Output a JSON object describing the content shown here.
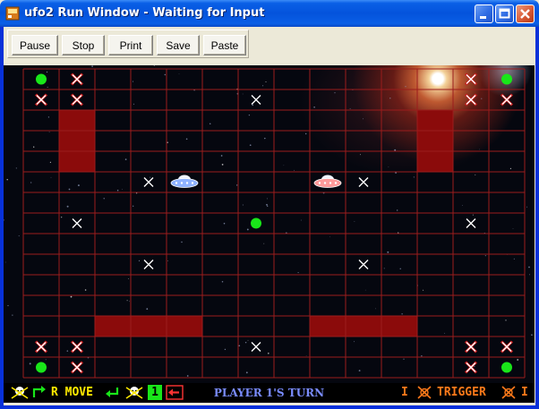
{
  "window": {
    "title": "ufo2 Run Window - Waiting for Input"
  },
  "toolbar": {
    "buttons": [
      {
        "id": "pause",
        "label": "Pause"
      },
      {
        "id": "stop",
        "label": "Stop"
      },
      {
        "id": "print",
        "label": "Print"
      },
      {
        "id": "save",
        "label": "Save"
      },
      {
        "id": "paste",
        "label": "Paste"
      }
    ]
  },
  "game": {
    "grid": {
      "cols": 14,
      "rows": 15
    },
    "colors": {
      "grid_line": "#9b1c1c",
      "wall": "#8b0b0b",
      "orb": "#19e619",
      "mark": "#ffffff"
    },
    "walls": [
      {
        "col": 1,
        "row": 2,
        "w": 1,
        "h": 3
      },
      {
        "col": 11,
        "row": 2,
        "w": 1,
        "h": 3
      },
      {
        "col": 2,
        "row": 12,
        "w": 3,
        "h": 1
      },
      {
        "col": 8,
        "row": 12,
        "w": 3,
        "h": 1
      }
    ],
    "orbs": [
      {
        "col": 0,
        "row": 0
      },
      {
        "col": 13,
        "row": 0
      },
      {
        "col": 6,
        "row": 7
      },
      {
        "col": 0,
        "row": 14
      },
      {
        "col": 13,
        "row": 14
      }
    ],
    "marks": [
      {
        "col": 1,
        "row": 0,
        "style": "red"
      },
      {
        "col": 12,
        "row": 0,
        "style": "red"
      },
      {
        "col": 0,
        "row": 1,
        "style": "red"
      },
      {
        "col": 1,
        "row": 1,
        "style": "red"
      },
      {
        "col": 6,
        "row": 1,
        "style": "white"
      },
      {
        "col": 12,
        "row": 1,
        "style": "red"
      },
      {
        "col": 13,
        "row": 1,
        "style": "red"
      },
      {
        "col": 3,
        "row": 5,
        "style": "white"
      },
      {
        "col": 9,
        "row": 5,
        "style": "white"
      },
      {
        "col": 1,
        "row": 7,
        "style": "white"
      },
      {
        "col": 12,
        "row": 7,
        "style": "white"
      },
      {
        "col": 3,
        "row": 9,
        "style": "white"
      },
      {
        "col": 9,
        "row": 9,
        "style": "white"
      },
      {
        "col": 0,
        "row": 13,
        "style": "red"
      },
      {
        "col": 1,
        "row": 13,
        "style": "red"
      },
      {
        "col": 6,
        "row": 13,
        "style": "white"
      },
      {
        "col": 12,
        "row": 13,
        "style": "red"
      },
      {
        "col": 13,
        "row": 13,
        "style": "red"
      },
      {
        "col": 1,
        "row": 14,
        "style": "red"
      },
      {
        "col": 12,
        "row": 14,
        "style": "red"
      }
    ],
    "ufos": [
      {
        "player": 1,
        "col": 4,
        "row": 5,
        "color": "#8fb2ff"
      },
      {
        "player": 2,
        "col": 8,
        "row": 5,
        "color": "#ff9a9a"
      }
    ]
  },
  "status": {
    "left_move_label": "R MOVE",
    "player_number": "1",
    "turn_text": "PLAYER 1'S TURN",
    "trigger_label": "TRIGGER",
    "bracket": "I",
    "colors": {
      "move": "#ffea00",
      "trigger": "#ff7a1a",
      "turn": "#7a8cff",
      "box": "#19e619"
    }
  }
}
